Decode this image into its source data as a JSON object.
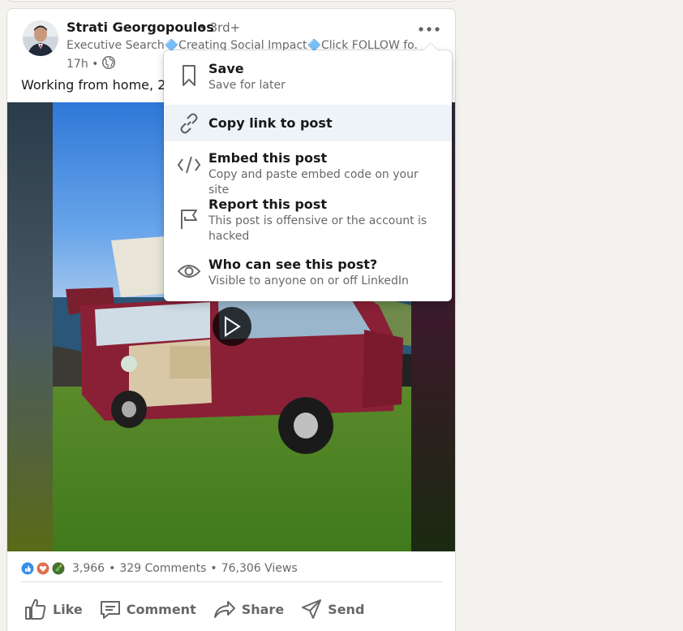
{
  "post": {
    "author": "Strati Georgopoulos",
    "degree": "• 3rd+",
    "headline": "Executive Search🔷Creating Social Impact🔷Click FOLLOW fo...",
    "time": "17h •",
    "text": "Working from home, 2",
    "reaction_count": "3,966",
    "comments": "329 Comments",
    "views": "76,306 Views",
    "sep": "•"
  },
  "actions": {
    "like": "Like",
    "comment": "Comment",
    "share": "Share",
    "send": "Send"
  },
  "menu": {
    "items": [
      {
        "title": "Save",
        "subtitle": "Save for later",
        "icon": "bookmark-icon"
      },
      {
        "title": "Copy link to post",
        "subtitle": "",
        "icon": "link-icon"
      },
      {
        "title": "Embed this post",
        "subtitle": "Copy and paste embed code on your site",
        "icon": "code-icon"
      },
      {
        "title": "Report this post",
        "subtitle": "This post is offensive or the account is hacked",
        "icon": "flag-icon"
      },
      {
        "title": "Who can see this post?",
        "subtitle": "Visible to anyone on or off LinkedIn",
        "icon": "eye-icon"
      }
    ]
  },
  "colors": {
    "background": "#f3f2ef",
    "menu_highlight": "#eef3f8",
    "text_secondary": "rgba(0,0,0,0.6)"
  }
}
